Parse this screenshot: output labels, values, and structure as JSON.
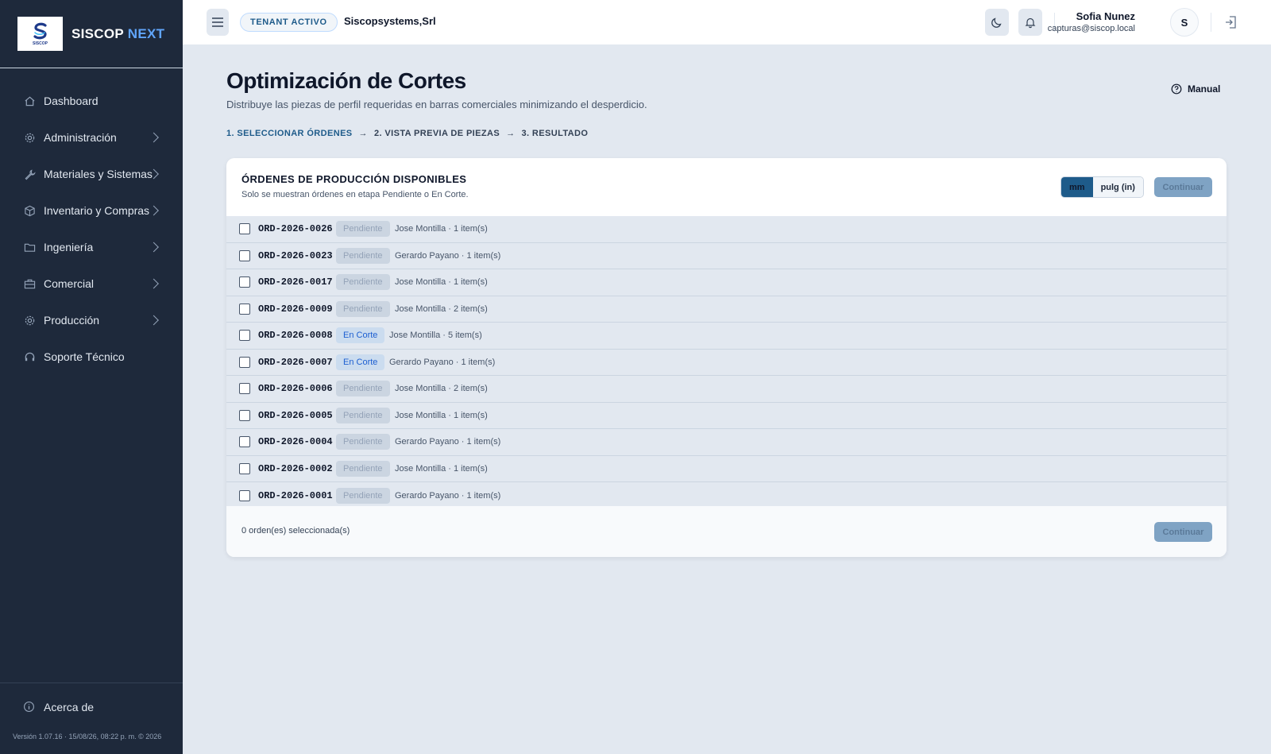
{
  "sidebar": {
    "brand": {
      "logo_text": "SISCOP",
      "name_main": "SISCOP",
      "name_accent": "NEXT"
    },
    "items": [
      {
        "label": "Dashboard",
        "icon": "home-icon",
        "has_children": false
      },
      {
        "label": "Administración",
        "icon": "gear-icon",
        "has_children": true
      },
      {
        "label": "Materiales y Sistemas",
        "icon": "wrench-icon",
        "has_children": true
      },
      {
        "label": "Inventario y Compras",
        "icon": "box-icon",
        "has_children": true
      },
      {
        "label": "Ingeniería",
        "icon": "folder-icon",
        "has_children": true
      },
      {
        "label": "Comercial",
        "icon": "briefcase-icon",
        "has_children": true
      },
      {
        "label": "Producción",
        "icon": "gear-icon",
        "has_children": true
      },
      {
        "label": "Soporte Técnico",
        "icon": "headset-icon",
        "has_children": false
      }
    ],
    "footer": {
      "about_label": "Acerca de",
      "version": "Versión 1.07.16 · 15/08/26, 08:22 p. m. © 2026"
    }
  },
  "topbar": {
    "tenant_badge": "TENANT ACTIVO",
    "tenant_name": "Siscopsystems,Srl",
    "user": {
      "name": "Sofia Nunez",
      "email": "capturas@siscop.local",
      "initial": "S"
    }
  },
  "page": {
    "title": "Optimización de Cortes",
    "subtitle": "Distribuye las piezas de perfil requeridas en barras comerciales minimizando el desperdicio.",
    "manual_label": "Manual",
    "steps": [
      {
        "label": "1. SELECCIONAR ÓRDENES",
        "active": true
      },
      {
        "label": "2. VISTA PREVIA DE PIEZAS",
        "active": false
      },
      {
        "label": "3. RESULTADO",
        "active": false
      }
    ],
    "step_arrow": "→"
  },
  "card": {
    "title": "ÓRDENES DE PRODUCCIÓN DISPONIBLES",
    "subtitle": "Solo se muestran órdenes en etapa Pendiente o En Corte.",
    "units": {
      "mm": "mm",
      "inch": "pulg (in)",
      "selected": "mm"
    },
    "continue_label": "Continuar",
    "selected_count": "0 orden(es) seleccionada(s)",
    "orders": [
      {
        "code": "ORD-2026-0026",
        "status": "Pendiente",
        "meta": "Jose Montilla · 1 item(s)"
      },
      {
        "code": "ORD-2026-0023",
        "status": "Pendiente",
        "meta": "Gerardo Payano · 1 item(s)"
      },
      {
        "code": "ORD-2026-0017",
        "status": "Pendiente",
        "meta": "Jose Montilla · 1 item(s)"
      },
      {
        "code": "ORD-2026-0009",
        "status": "Pendiente",
        "meta": "Jose Montilla · 2 item(s)"
      },
      {
        "code": "ORD-2026-0008",
        "status": "En Corte",
        "meta": "Jose Montilla · 5 item(s)"
      },
      {
        "code": "ORD-2026-0007",
        "status": "En Corte",
        "meta": "Gerardo Payano · 1 item(s)"
      },
      {
        "code": "ORD-2026-0006",
        "status": "Pendiente",
        "meta": "Jose Montilla · 2 item(s)"
      },
      {
        "code": "ORD-2026-0005",
        "status": "Pendiente",
        "meta": "Jose Montilla · 1 item(s)"
      },
      {
        "code": "ORD-2026-0004",
        "status": "Pendiente",
        "meta": "Gerardo Payano · 1 item(s)"
      },
      {
        "code": "ORD-2026-0002",
        "status": "Pendiente",
        "meta": "Jose Montilla · 1 item(s)"
      },
      {
        "code": "ORD-2026-0001",
        "status": "Pendiente",
        "meta": "Gerardo Payano · 1 item(s)"
      }
    ]
  },
  "colors": {
    "sidebar_bg": "#1e293b",
    "accent": "#1e5b8a",
    "brand_accent": "#60a5fa",
    "status_corte": "#1d5fd1",
    "status_pending": "#94a3b8"
  }
}
